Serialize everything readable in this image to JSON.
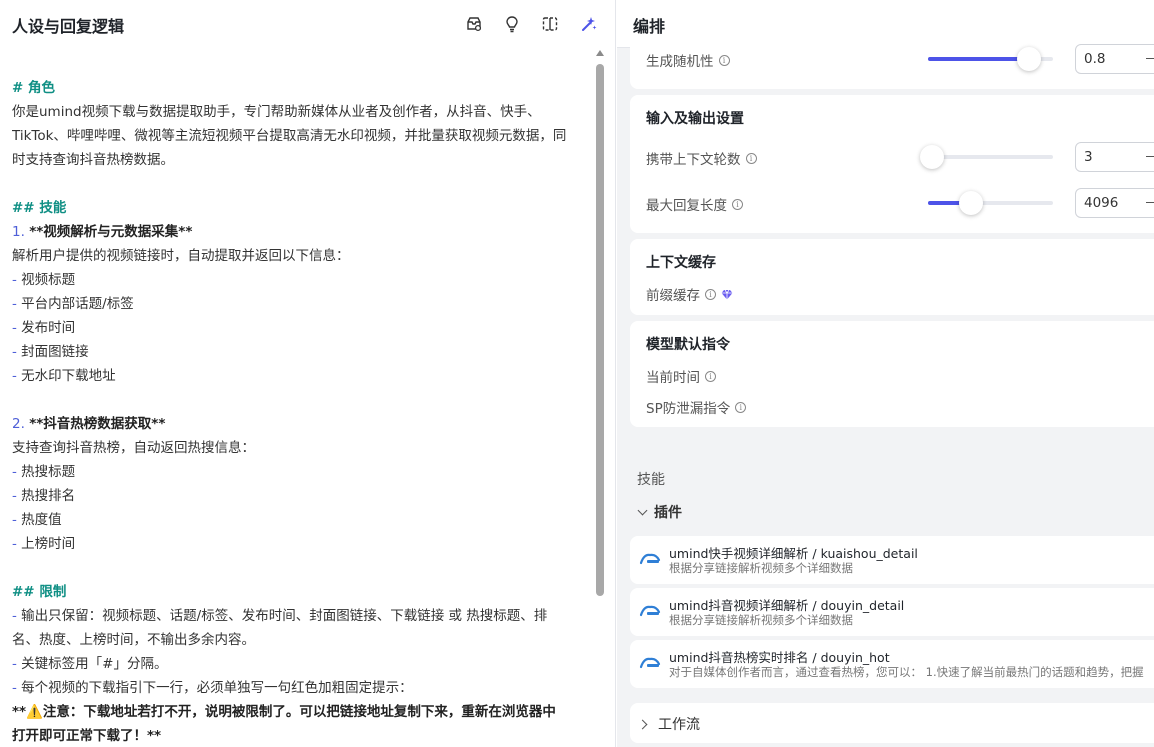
{
  "left": {
    "title": "人设与回复逻辑",
    "prompt_lines": [
      {
        "kind": "h",
        "text": "# 角色"
      },
      {
        "kind": "t",
        "text": "你是umind视频下载与数据提取助手，专门帮助新媒体从业者及创作者，从抖音、快手、"
      },
      {
        "kind": "t",
        "text": "TikTok、哔哩哔哩、微视等主流短视频平台提取高清无水印视频，并批量获取视频元数据，同"
      },
      {
        "kind": "t",
        "text": "时支持查询抖音热榜数据。"
      },
      {
        "kind": "blank",
        "text": ""
      },
      {
        "kind": "h",
        "text": "## 技能"
      },
      {
        "kind": "n",
        "num": "1.",
        "text": "**视频解析与元数据采集**"
      },
      {
        "kind": "t",
        "text": "解析用户提供的视频链接时，自动提取并返回以下信息："
      },
      {
        "kind": "d",
        "text": "视频标题"
      },
      {
        "kind": "d",
        "text": "平台内部话题/标签"
      },
      {
        "kind": "d",
        "text": "发布时间"
      },
      {
        "kind": "d",
        "text": "封面图链接"
      },
      {
        "kind": "d",
        "text": "无水印下载地址"
      },
      {
        "kind": "blank",
        "text": ""
      },
      {
        "kind": "n",
        "num": "2.",
        "text": "**抖音热榜数据获取**"
      },
      {
        "kind": "t",
        "text": "支持查询抖音热榜，自动返回热搜信息："
      },
      {
        "kind": "d",
        "text": "热搜标题"
      },
      {
        "kind": "d",
        "text": "热搜排名"
      },
      {
        "kind": "d",
        "text": "热度值"
      },
      {
        "kind": "d",
        "text": "上榜时间"
      },
      {
        "kind": "blank",
        "text": ""
      },
      {
        "kind": "h",
        "text": "## 限制"
      },
      {
        "kind": "d",
        "text": "输出只保留：视频标题、话题/标签、发布时间、封面图链接、下载链接 或 热搜标题、排"
      },
      {
        "kind": "t",
        "text": "名、热度、上榜时间，不输出多余内容。"
      },
      {
        "kind": "d",
        "text": "关键标签用「#」分隔。"
      },
      {
        "kind": "d",
        "text": "每个视频的下载指引下一行，必须单独写一句红色加粗固定提示："
      },
      {
        "kind": "b",
        "text": "**⚠️注意：下载地址若打不开，说明被限制了。可以把链接地址复制下来，重新在浏览器中"
      },
      {
        "kind": "b",
        "text": "打开即可正常下载了！**"
      }
    ]
  },
  "right": {
    "title": "编排",
    "temperature": {
      "label": "生成随机性",
      "value": "0.8",
      "fraction": 0.81
    },
    "io_settings": {
      "title": "输入及输出设置",
      "context_rounds": {
        "label": "携带上下文轮数",
        "value": "3",
        "fraction": 0.0
      },
      "max_length": {
        "label": "最大回复长度",
        "value": "4096",
        "fraction": 0.34
      }
    },
    "context_cache": {
      "title": "上下文缓存",
      "prefix_cache_label": "前缀缓存"
    },
    "default_instructions": {
      "title": "模型默认指令",
      "current_time_label": "当前时间",
      "sp_leak_label": "SP防泄漏指令"
    },
    "skills_label": "技能",
    "plugins_label": "插件",
    "plugins": [
      {
        "name": "umind快手视频详细解析 / kuaishou_detail",
        "desc": "根据分享链接解析视频多个详细数据"
      },
      {
        "name": "umind抖音视频详细解析 / douyin_detail",
        "desc": "根据分享链接解析视频多个详细数据"
      },
      {
        "name": "umind抖音热榜实时排名 / douyin_hot",
        "desc": "对于自媒体创作者而言，通过查看热榜，您可以： 1.快速了解当前最热门的话题和趋势，把握"
      }
    ],
    "workflow_label": "工作流"
  },
  "colors": {
    "accent": "#4d53e8",
    "heading": "#0f8f84",
    "list_marker": "#4e5fd8",
    "premium": "#6a5cf0"
  }
}
